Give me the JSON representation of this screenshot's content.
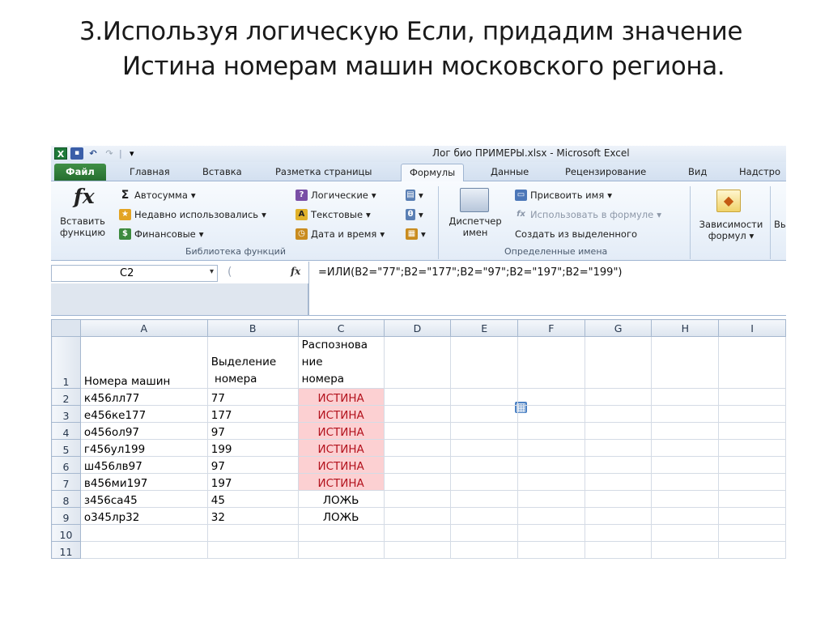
{
  "slide": {
    "title_line1": "3.Используя логическую Если, придадим значение",
    "title_line2": "Истина номерам машин московского региона."
  },
  "window": {
    "title": "Лог био ПРИМЕРЫ.xlsx  -  Microsoft Excel",
    "qat_separator": "|"
  },
  "tabs": [
    {
      "label": "Файл"
    },
    {
      "label": "Главная"
    },
    {
      "label": "Вставка"
    },
    {
      "label": "Разметка страницы"
    },
    {
      "label": "Формулы"
    },
    {
      "label": "Данные"
    },
    {
      "label": "Рецензирование"
    },
    {
      "label": "Вид"
    },
    {
      "label": "Надстро"
    }
  ],
  "ribbon": {
    "insert_function": {
      "line1": "Вставить",
      "line2": "функцию"
    },
    "autosum": "Автосумма",
    "recent": "Недавно использовались",
    "financial": "Финансовые",
    "logical": "Логические",
    "text": "Текстовые",
    "datetime": "Дата и время",
    "library_group": "Библиотека функций",
    "name_manager": {
      "line1": "Диспетчер",
      "line2": "имен"
    },
    "assign_name": "Присвоить имя",
    "use_in_formula": "Использовать в формуле",
    "create_from_selection": "Создать из выделенного",
    "names_group": "Определенные имена",
    "dependencies": {
      "line1": "Зависимости",
      "line2": "формул"
    },
    "cut_label": "Вь",
    "dropdown_glyph": "▾",
    "fx_glyph": "fx",
    "fx_small": "fx",
    "sigma_glyph": "Σ",
    "warning_glyph": "◆"
  },
  "formula_bar": {
    "name_box": "C2",
    "dropdown_glyph": "▾",
    "cancel_glyph": "(",
    "fx_glyph": "fx",
    "formula": "=ИЛИ(B2=\"77\";B2=\"177\";B2=\"97\";B2=\"197\";B2=\"199\")"
  },
  "grid": {
    "columns": [
      "A",
      "B",
      "C",
      "D",
      "E",
      "F",
      "G",
      "H",
      "I"
    ],
    "header_row": {
      "row": "1",
      "a": "Номера машин",
      "b_line1": "Выделение",
      "b_line2": " номера",
      "c_line1": "Распознова",
      "c_line2": "ние",
      "c_line3": "номера"
    },
    "rows": [
      {
        "row": "2",
        "a": "к456лл77",
        "b": "77",
        "c": "ИСТИНА"
      },
      {
        "row": "3",
        "a": "е456ке177",
        "b": "177",
        "c": "ИСТИНА"
      },
      {
        "row": "4",
        "a": "о456ол97",
        "b": "97",
        "c": "ИСТИНА"
      },
      {
        "row": "5",
        "a": "г456ул199",
        "b": "199",
        "c": "ИСТИНА"
      },
      {
        "row": "6",
        "a": "ш456лв97",
        "b": "97",
        "c": "ИСТИНА"
      },
      {
        "row": "7",
        "a": "в456ми197",
        "b": "197",
        "c": "ИСТИНА"
      },
      {
        "row": "8",
        "a": "з456са45",
        "b": "45",
        "c": "ЛОЖЬ"
      },
      {
        "row": "9",
        "a": "о345лр32",
        "b": "32",
        "c": "ЛОЖЬ"
      },
      {
        "row": "10",
        "a": "",
        "b": "",
        "c": ""
      },
      {
        "row": "11",
        "a": "",
        "b": "",
        "c": ""
      }
    ]
  },
  "colors": {
    "true_fill": "#fcd0d2",
    "true_text": "#b3121d",
    "file_tab": "#2f7d38"
  }
}
